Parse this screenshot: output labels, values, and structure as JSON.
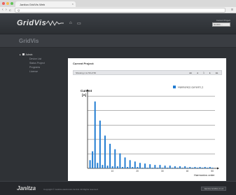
{
  "browser": {
    "tab_title": "Janitza GridVis Web",
    "tab_close": "×",
    "url": "Q",
    "back_glyph": "‹",
    "forward_glyph": "›",
    "reload_glyph": "C",
    "menu_glyph": "≡",
    "traffic_colors": [
      "#ec5f5a",
      "#f5be4f",
      "#5fc454"
    ]
  },
  "header": {
    "logo": "GridVis",
    "home_icon": "home-icon",
    "window_icon": "window-icon",
    "current_project_label": "Current Project",
    "current_project_value": "GridVis ..."
  },
  "sub_header": {
    "title": "GridVis"
  },
  "sidebar": {
    "root_label": "Admin",
    "items": [
      "Device List",
      "Status Project",
      "Programs",
      "License"
    ]
  },
  "main": {
    "title": "Current Project:",
    "toolbar_text": "Showing 1 to 50 of 50",
    "toolbar_buttons": [
      "◂◂",
      "◂",
      "1",
      "▸",
      "▸▸"
    ]
  },
  "chart_data": {
    "type": "bar",
    "ylabel": "Current",
    "yunit": "[A]",
    "xlabel": "Harmonics order",
    "legend": "Harmonics current L1",
    "legend_position": "top-right",
    "x_ticks": [
      10,
      20,
      30,
      40,
      50
    ],
    "x": [
      1,
      2,
      3,
      4,
      5,
      6,
      7,
      8,
      9,
      10,
      11,
      12,
      13,
      14,
      15,
      16,
      17,
      18,
      19,
      20,
      21,
      22,
      23,
      24,
      25,
      26,
      27,
      28,
      29,
      30,
      31,
      32,
      33,
      34,
      35,
      36,
      37,
      38,
      39,
      40,
      41,
      42,
      43,
      44,
      45,
      46,
      47,
      48,
      49,
      50
    ],
    "values": [
      12,
      25,
      98,
      8,
      70,
      5,
      48,
      4,
      36,
      3,
      28,
      3,
      22,
      2,
      16,
      2,
      12,
      2,
      10,
      2,
      8,
      1,
      7,
      1,
      6,
      1,
      5,
      1,
      5,
      1,
      4,
      1,
      4,
      1,
      3,
      1,
      3,
      1,
      3,
      1,
      2,
      1,
      2,
      1,
      2,
      1,
      2,
      1,
      2,
      1
    ],
    "ylim": [
      0,
      110
    ],
    "grid_lines": 5,
    "bar_color": "#1f7bd1"
  },
  "footer": {
    "brand": "Janitza",
    "copyright": "Copyright © Janitza electronics GmbH. All Rights reserved.",
    "version": "Janitza GridVis 2.1.0"
  }
}
